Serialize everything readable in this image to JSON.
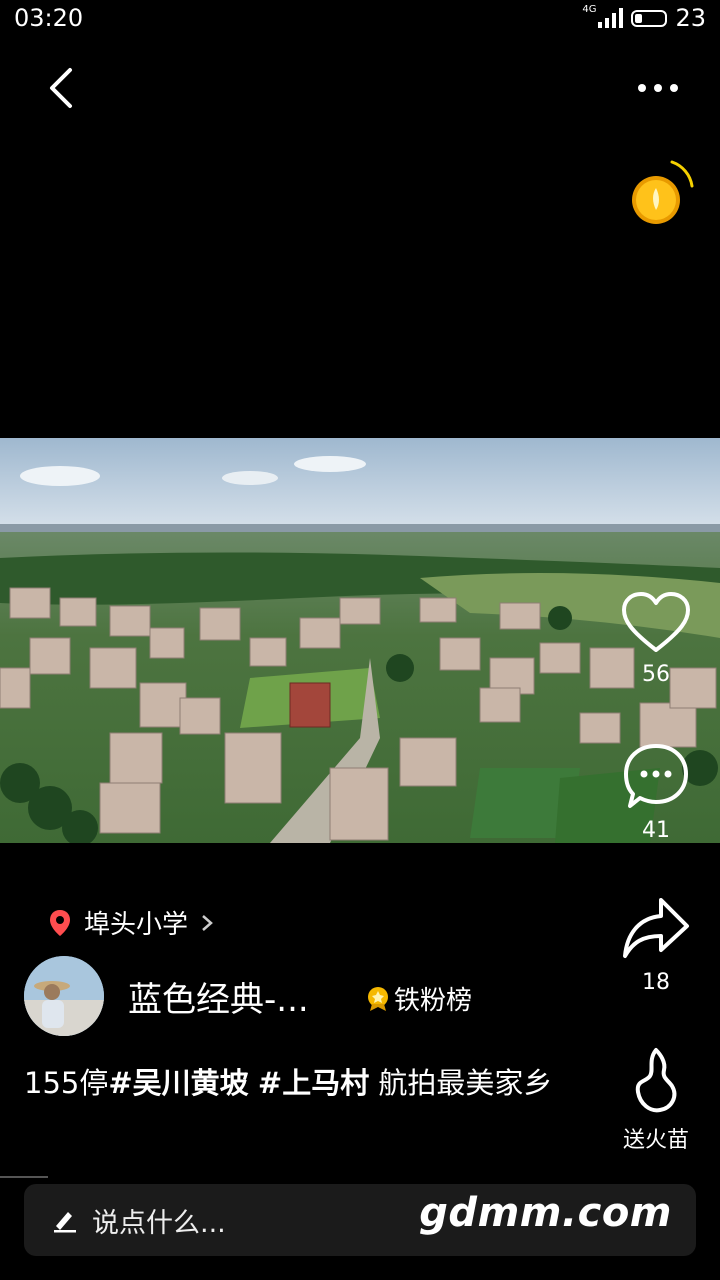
{
  "status_bar": {
    "time": "03:20",
    "network": "4G",
    "battery_level": "23"
  },
  "icons": {
    "back": "chevron-left-icon",
    "more": "more-dots-icon",
    "coin": "gold-coin-icon",
    "like": "heart-icon",
    "comment": "comment-bubble-icon",
    "share": "share-arrow-icon",
    "gift": "flame-icon",
    "location": "location-pin-icon",
    "edit": "pencil-icon"
  },
  "actions": {
    "like_count": "56",
    "comment_count": "41",
    "share_count": "18",
    "gift_label": "送火苗"
  },
  "post": {
    "location": "埠头小学",
    "author": "蓝色经典-...",
    "fans_badge": "铁粉榜",
    "caption_prefix": "155停",
    "caption_tag1": "#吴川黄坡",
    "caption_tag2": "#上马村",
    "caption_text": "航拍最美家乡"
  },
  "comment_input": {
    "placeholder": "说点什么..."
  },
  "watermark": "gdmm.com",
  "colors": {
    "background": "#000000",
    "pin": "#ff4d4f",
    "coin": "#f5b800"
  }
}
